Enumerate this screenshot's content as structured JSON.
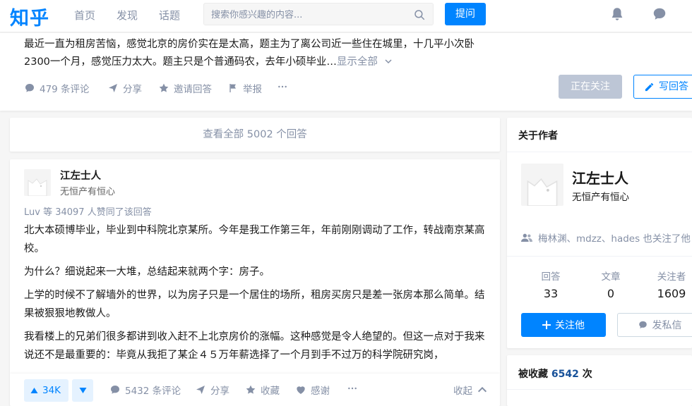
{
  "nav": {
    "logo": "知乎",
    "items": [
      "首页",
      "发现",
      "话题"
    ],
    "search_placeholder": "搜索你感兴趣的内容...",
    "ask_button": "提问"
  },
  "question": {
    "description": "最近一直为租房苦恼，感觉北京的房价实在是太高，题主为了离公司近一些住在城里，十几平小次卧2300一个月，感觉压力太大。题主只是个普通码农，去年小硕毕业…",
    "show_all": "显示全部",
    "comments": "479 条评论",
    "share": "分享",
    "invite": "邀请回答",
    "report": "举报",
    "following_button": "正在关注",
    "write_answer_button": "写回答"
  },
  "view_all_answers": "查看全部 5002 个回答",
  "answer": {
    "author_name": "江左士人",
    "author_bio": "无恒产有恒心",
    "upvoters": "Luv 等 34097 人赞同了该回答",
    "paragraphs": [
      "北大本硕博毕业，毕业到中科院北京某所。今年是我工作第三年，年前刚刚调动了工作，转战南京某高校。",
      "为什么？细说起来一大堆，总结起来就两个字：房子。",
      "上学的时候不了解墙外的世界，以为房子只是一个居住的场所，租房买房只是差一张房本那么简单。结果被狠狠地教做人。",
      "我看楼上的兄弟们很多都讲到收入赶不上北京房价的涨幅。这种感觉是令人绝望的。但这一点对于我来说还不是最重要的：毕竟从我拒了某企４５万年薪选择了一个月到手不过万的科学院研究岗，"
    ],
    "vote_count": "34K",
    "comments": "5432 条评论",
    "share": "分享",
    "collect": "收藏",
    "thanks": "感谢",
    "collapse": "收起"
  },
  "sidebar": {
    "about_title": "关于作者",
    "name": "江左士人",
    "bio": "无恒产有恒心",
    "mutual_follow": "梅林渊、mdzz、hades 也关注了他",
    "stats": [
      {
        "label": "回答",
        "value": "33"
      },
      {
        "label": "文章",
        "value": "0"
      },
      {
        "label": "关注者",
        "value": "1609"
      }
    ],
    "follow_button": "关注他",
    "message_button": "发私信",
    "collected_prefix": "被收藏",
    "collected_count": "6542",
    "collected_suffix": "次"
  },
  "colors": {
    "brand": "#0084ff",
    "muted": "#8590a6",
    "disabled_button": "#bdc6d6"
  }
}
